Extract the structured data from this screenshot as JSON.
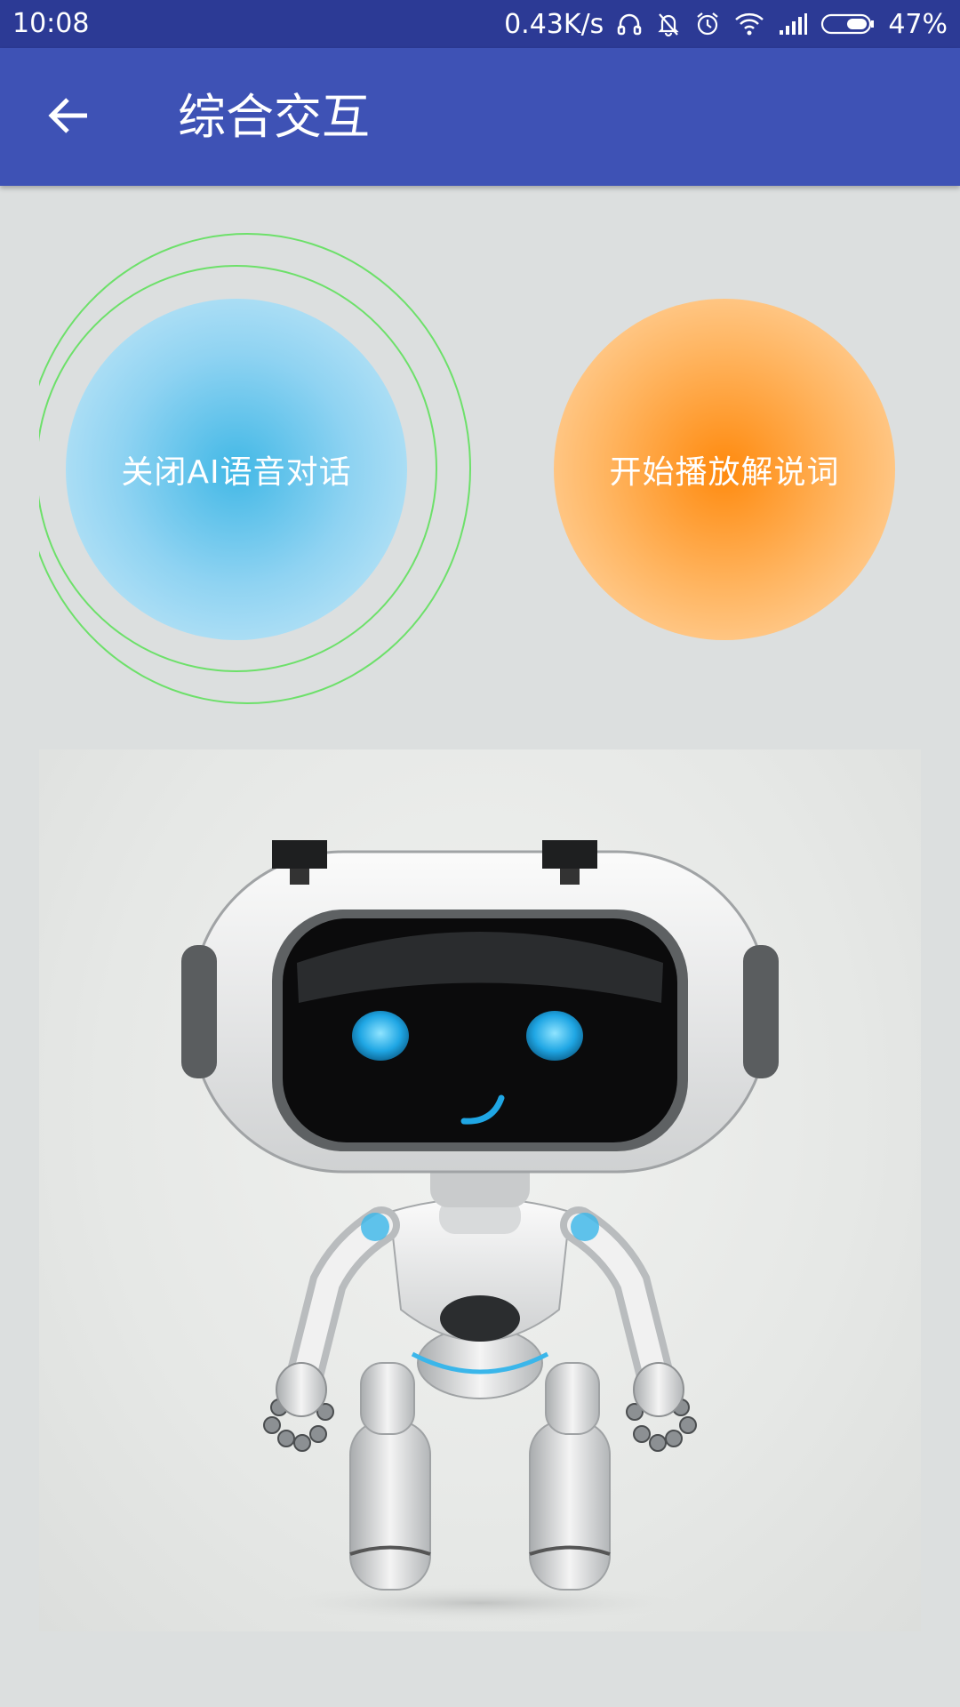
{
  "status_bar": {
    "time": "10:08",
    "net_speed": "0.43K/s",
    "battery": "47%",
    "icons": [
      "headphones-icon",
      "bell-off-icon",
      "alarm-icon",
      "wifi-icon",
      "signal-icon",
      "battery-icon"
    ]
  },
  "app_bar": {
    "back_icon": "arrow-left-icon",
    "title": "综合交互",
    "color": "#3e52b5"
  },
  "actions": {
    "voice_chat_label": "关闭AI语音对话",
    "narration_label": "开始播放解说词",
    "voice_color": "#42b8e6",
    "narration_color": "#ff8a0e",
    "ring_color": "#6de06a"
  },
  "image": {
    "subject": "robot-illustration"
  }
}
